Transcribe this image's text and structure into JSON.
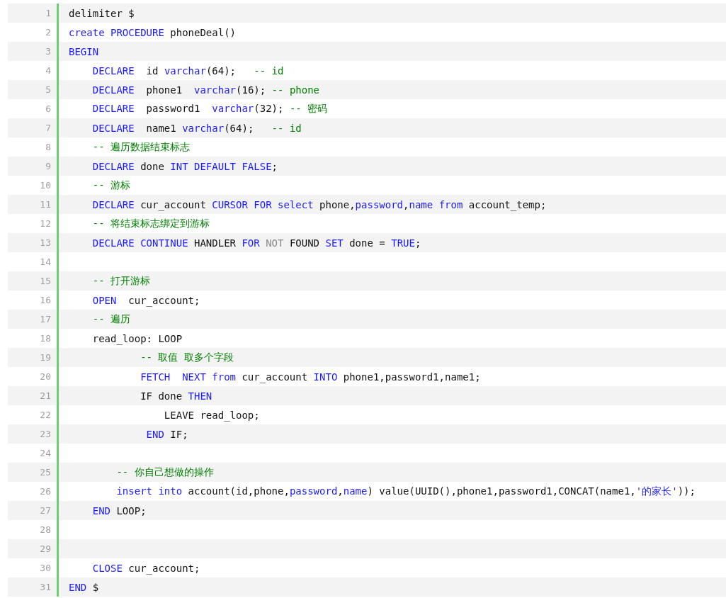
{
  "code_lines": [
    {
      "number": "1",
      "tokens": [
        {
          "kind": "plain",
          "text": "delimiter $"
        }
      ]
    },
    {
      "number": "2",
      "tokens": [
        {
          "kind": "kw",
          "text": "create PROCEDURE"
        },
        {
          "kind": "plain",
          "text": " phoneDeal()"
        }
      ]
    },
    {
      "number": "3",
      "tokens": [
        {
          "kind": "kw",
          "text": "BEGIN"
        }
      ]
    },
    {
      "number": "4",
      "tokens": [
        {
          "kind": "kw",
          "text": "    DECLARE"
        },
        {
          "kind": "plain",
          "text": "  id "
        },
        {
          "kind": "kw",
          "text": "varchar"
        },
        {
          "kind": "plain",
          "text": "(64);   "
        },
        {
          "kind": "cmt",
          "text": "-- id"
        }
      ]
    },
    {
      "number": "5",
      "tokens": [
        {
          "kind": "kw",
          "text": "    DECLARE"
        },
        {
          "kind": "plain",
          "text": "  phone1  "
        },
        {
          "kind": "kw",
          "text": "varchar"
        },
        {
          "kind": "plain",
          "text": "(16); "
        },
        {
          "kind": "cmt",
          "text": "-- phone"
        }
      ]
    },
    {
      "number": "6",
      "tokens": [
        {
          "kind": "kw",
          "text": "    DECLARE"
        },
        {
          "kind": "plain",
          "text": "  password1  "
        },
        {
          "kind": "kw",
          "text": "varchar"
        },
        {
          "kind": "plain",
          "text": "(32); "
        },
        {
          "kind": "cmt",
          "text": "-- 密码"
        }
      ]
    },
    {
      "number": "7",
      "tokens": [
        {
          "kind": "kw",
          "text": "    DECLARE"
        },
        {
          "kind": "plain",
          "text": "  name1 "
        },
        {
          "kind": "kw",
          "text": "varchar"
        },
        {
          "kind": "plain",
          "text": "(64);   "
        },
        {
          "kind": "cmt",
          "text": "-- id"
        }
      ]
    },
    {
      "number": "8",
      "tokens": [
        {
          "kind": "cmt",
          "text": "    -- 遍历数据结束标志"
        }
      ]
    },
    {
      "number": "9",
      "tokens": [
        {
          "kind": "kw",
          "text": "    DECLARE"
        },
        {
          "kind": "plain",
          "text": " done "
        },
        {
          "kind": "kw",
          "text": "INT DEFAULT FALSE"
        },
        {
          "kind": "plain",
          "text": ";"
        }
      ]
    },
    {
      "number": "10",
      "tokens": [
        {
          "kind": "cmt",
          "text": "    -- 游标"
        }
      ]
    },
    {
      "number": "11",
      "tokens": [
        {
          "kind": "kw",
          "text": "    DECLARE"
        },
        {
          "kind": "plain",
          "text": " cur_account "
        },
        {
          "kind": "kw",
          "text": "CURSOR FOR select"
        },
        {
          "kind": "plain",
          "text": " phone,"
        },
        {
          "kind": "kw",
          "text": "password"
        },
        {
          "kind": "plain",
          "text": ","
        },
        {
          "kind": "kw",
          "text": "name from"
        },
        {
          "kind": "plain",
          "text": " account_temp;"
        }
      ]
    },
    {
      "number": "12",
      "tokens": [
        {
          "kind": "cmt",
          "text": "    -- 将结束标志绑定到游标"
        }
      ]
    },
    {
      "number": "13",
      "tokens": [
        {
          "kind": "kw",
          "text": "    DECLARE CONTINUE"
        },
        {
          "kind": "plain",
          "text": " HANDLER "
        },
        {
          "kind": "kw",
          "text": "FOR "
        },
        {
          "kind": "dim",
          "text": "NOT"
        },
        {
          "kind": "plain",
          "text": " FOUND "
        },
        {
          "kind": "kw",
          "text": "SET"
        },
        {
          "kind": "plain",
          "text": " done = "
        },
        {
          "kind": "kw",
          "text": "TRUE"
        },
        {
          "kind": "plain",
          "text": ";"
        }
      ]
    },
    {
      "number": "14"
    },
    {
      "number": "15",
      "tokens": [
        {
          "kind": "cmt",
          "text": "    -- 打开游标"
        }
      ]
    },
    {
      "number": "16",
      "tokens": [
        {
          "kind": "kw",
          "text": "    OPEN"
        },
        {
          "kind": "plain",
          "text": "  cur_account;"
        }
      ]
    },
    {
      "number": "17",
      "tokens": [
        {
          "kind": "cmt",
          "text": "    -- 遍历"
        }
      ]
    },
    {
      "number": "18",
      "tokens": [
        {
          "kind": "plain",
          "text": "    read_loop: LOOP"
        }
      ]
    },
    {
      "number": "19",
      "tokens": [
        {
          "kind": "cmt",
          "text": "            -- 取值 取多个字段"
        }
      ]
    },
    {
      "number": "20",
      "tokens": [
        {
          "kind": "kw",
          "text": "            FETCH  NEXT from"
        },
        {
          "kind": "plain",
          "text": " cur_account "
        },
        {
          "kind": "kw",
          "text": "INTO"
        },
        {
          "kind": "plain",
          "text": " phone1,password1,name1;"
        }
      ]
    },
    {
      "number": "21",
      "tokens": [
        {
          "kind": "plain",
          "text": "            IF done "
        },
        {
          "kind": "kw",
          "text": "THEN"
        }
      ]
    },
    {
      "number": "22",
      "tokens": [
        {
          "kind": "plain",
          "text": "                LEAVE read_loop;"
        }
      ]
    },
    {
      "number": "23",
      "tokens": [
        {
          "kind": "kw",
          "text": "             END"
        },
        {
          "kind": "plain",
          "text": " IF;"
        }
      ]
    },
    {
      "number": "24"
    },
    {
      "number": "25",
      "tokens": [
        {
          "kind": "cmt",
          "text": "        -- 你自己想做的操作"
        }
      ]
    },
    {
      "number": "26",
      "tokens": [
        {
          "kind": "kw",
          "text": "        insert into"
        },
        {
          "kind": "plain",
          "text": " account(id,phone,"
        },
        {
          "kind": "kw",
          "text": "password"
        },
        {
          "kind": "plain",
          "text": ","
        },
        {
          "kind": "kw",
          "text": "name"
        },
        {
          "kind": "plain",
          "text": ") value(UUID(),phone1,password1,CONCAT(name1,"
        },
        {
          "kind": "str",
          "text": "'的家长'"
        },
        {
          "kind": "plain",
          "text": "));"
        }
      ]
    },
    {
      "number": "27",
      "tokens": [
        {
          "kind": "kw",
          "text": "    END"
        },
        {
          "kind": "plain",
          "text": " LOOP;"
        }
      ]
    },
    {
      "number": "28"
    },
    {
      "number": "29"
    },
    {
      "number": "30",
      "tokens": [
        {
          "kind": "kw",
          "text": "    CLOSE"
        },
        {
          "kind": "plain",
          "text": " cur_account;"
        }
      ]
    },
    {
      "number": "31",
      "tokens": [
        {
          "kind": "kw",
          "text": "END"
        },
        {
          "kind": "plain",
          "text": " $"
        }
      ]
    }
  ]
}
